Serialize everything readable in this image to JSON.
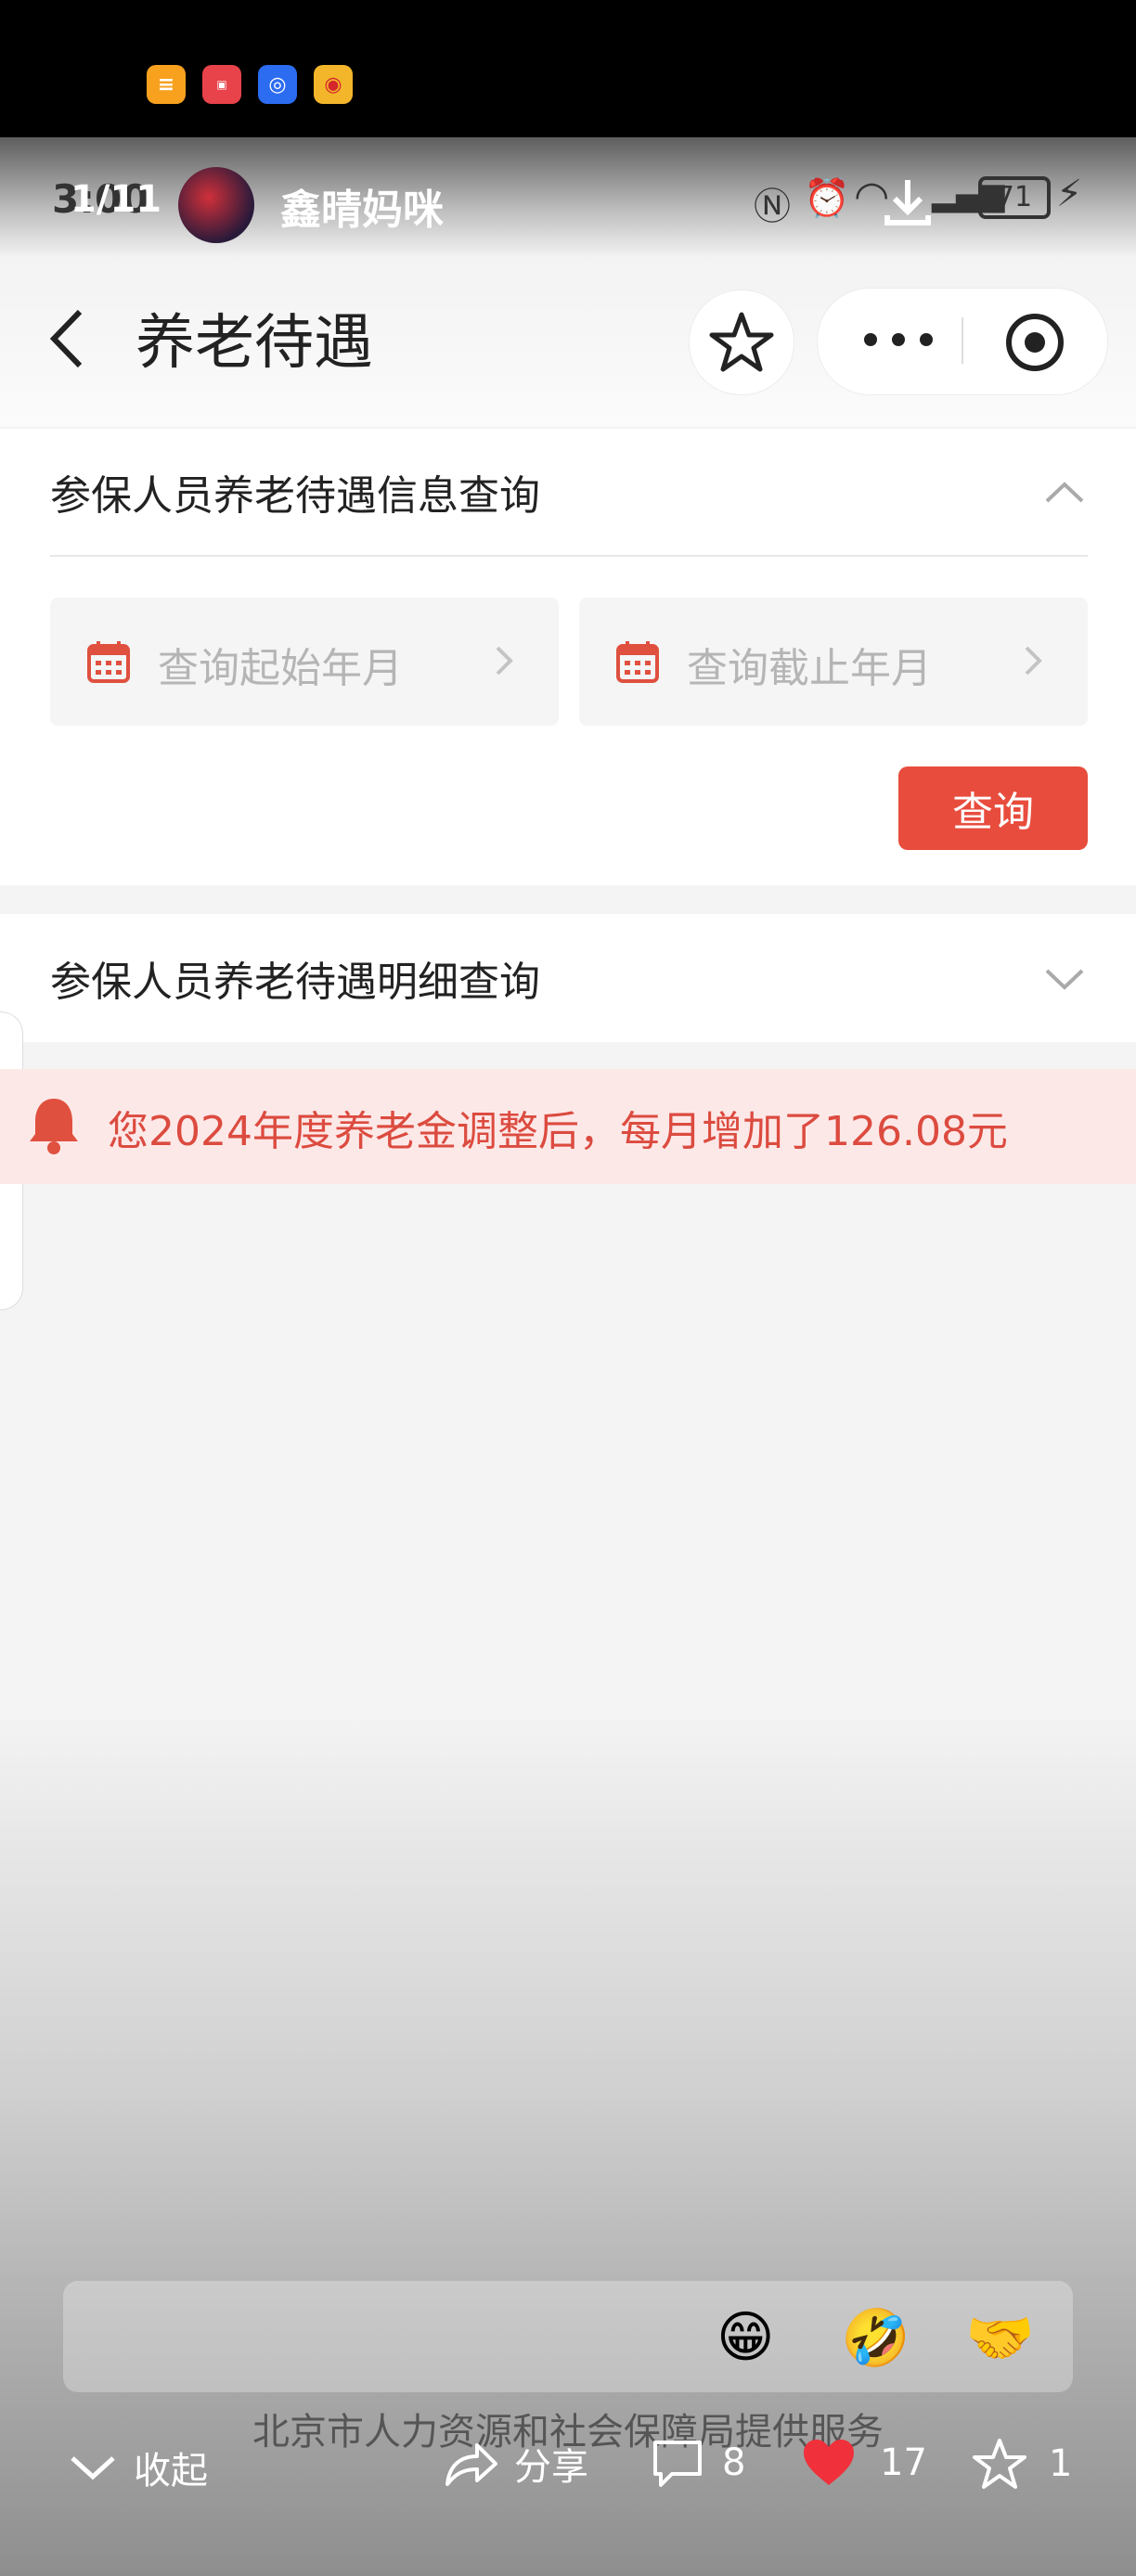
{
  "status_bar": {
    "time": "3:00",
    "counter": "1/11",
    "author": "鑫晴妈咪",
    "battery": "71"
  },
  "top_apps": [
    {
      "icon": "note-app-icon",
      "color": "#f7a11e"
    },
    {
      "icon": "huawei-store-icon",
      "color": "#e8424a"
    },
    {
      "icon": "browser-app-icon",
      "color": "#2c6cf0"
    },
    {
      "icon": "weibo-icon",
      "color": "#f3b62b"
    }
  ],
  "header": {
    "title": "养老待遇"
  },
  "section1": {
    "title": "参保人员养老待遇信息查询",
    "start_placeholder": "查询起始年月",
    "end_placeholder": "查询截止年月",
    "query_button": "查询"
  },
  "section2": {
    "title": "参保人员养老待遇明细查询"
  },
  "notice": {
    "text": "您2024年度养老金调整后，每月增加了126.08元"
  },
  "footer": {
    "provider": "北京市人力资源和社会保障局提供服务"
  },
  "bottom_bar": {
    "collapse": "收起",
    "share": "分享",
    "comments": "8",
    "likes": "17",
    "favorites": "1"
  },
  "emojis": [
    "😁",
    "🤣",
    "🤝"
  ],
  "colors": {
    "accent": "#e84c3d",
    "notice_bg": "#fde8e8",
    "notice_text": "#dc4b3f"
  }
}
